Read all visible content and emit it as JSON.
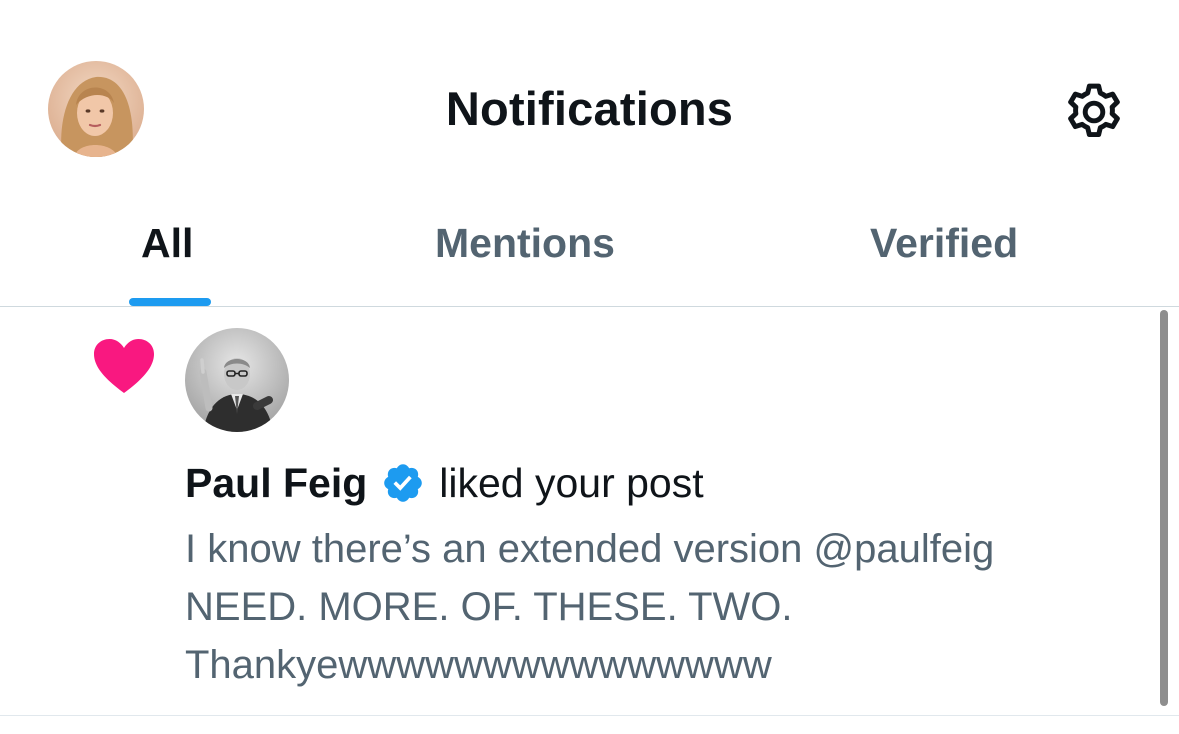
{
  "header": {
    "title": "Notifications",
    "profile_icon": "avatar",
    "settings_icon": "gear-icon"
  },
  "tabs": [
    {
      "label": "All",
      "active": true
    },
    {
      "label": "Mentions",
      "active": false
    },
    {
      "label": "Verified",
      "active": false
    }
  ],
  "notification": {
    "type_icon": "heart-icon",
    "type_color": "#f91880",
    "user": {
      "name": "Paul Feig",
      "verified": true,
      "badge_color": "#1d9bf0"
    },
    "action": "liked your post",
    "post_lines": [
      "I know there’s an extended version @paulfeig",
      "NEED. MORE. OF. THESE. TWO.",
      "Thankyewwwwwwwwwwwwwww"
    ]
  },
  "colors": {
    "accent": "#1d9bf0",
    "like": "#f91880",
    "secondary_text": "#536471",
    "primary_text": "#0f1419"
  }
}
